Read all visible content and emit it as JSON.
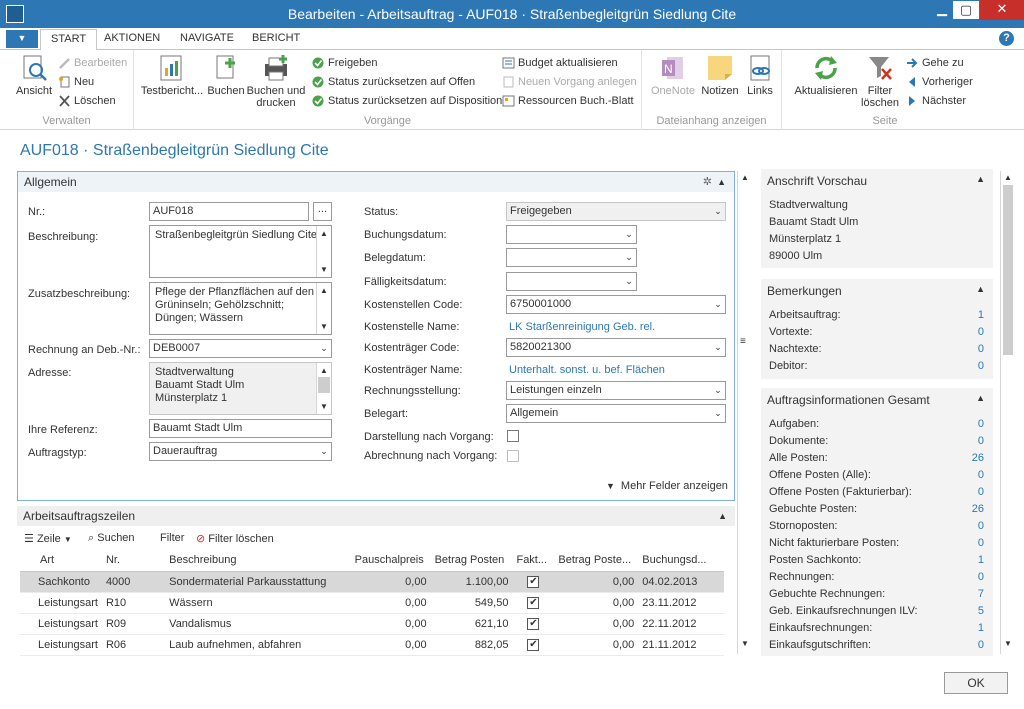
{
  "window": {
    "title": "Bearbeiten - Arbeitsauftrag - AUF018 · Straßenbegleitgrün Siedlung Cite",
    "minimize": "▁",
    "maximize": "▢",
    "close": "✕"
  },
  "ribbon_tabs": [
    "START",
    "AKTIONEN",
    "NAVIGATE",
    "BERICHT"
  ],
  "ribbon": {
    "verwalten": {
      "label": "Verwalten",
      "ansicht": "Ansicht",
      "bearbeiten": "Bearbeiten",
      "neu": "Neu",
      "loeschen": "Löschen"
    },
    "vorgaenge": {
      "label": "Vorgänge",
      "testbericht": "Testbericht...",
      "buchen": "Buchen",
      "buchen_drucken_1": "Buchen und",
      "buchen_drucken_2": "drucken",
      "freigeben": "Freigeben",
      "status_offen": "Status zurücksetzen auf Offen",
      "status_disposition": "Status zurücksetzen auf Disposition",
      "budget": "Budget aktualisieren",
      "neuer_vorgang": "Neuen Vorgang anlegen",
      "ressourcen": "Ressourcen Buch.-Blatt"
    },
    "dateianhang": {
      "label": "Dateianhang anzeigen",
      "onenote": "OneNote",
      "notizen": "Notizen",
      "links": "Links"
    },
    "seite": {
      "label": "Seite",
      "aktualisieren": "Aktualisieren",
      "filter_1": "Filter",
      "filter_2": "löschen",
      "gehe_zu": "Gehe zu",
      "vorheriger": "Vorheriger",
      "naechster": "Nächster"
    }
  },
  "page_title": "AUF018 · Straßenbegleitgrün Siedlung Cite",
  "allgemein": {
    "header": "Allgemein",
    "nr_label": "Nr.:",
    "nr_value": "AUF018",
    "nr_assist": "...",
    "beschreibung_label": "Beschreibung:",
    "beschreibung_value": "Straßenbegleitgrün Siedlung Cite",
    "zusatz_label": "Zusatzbeschreibung:",
    "zusatz_lines": [
      "Pflege der Pflanzflächen auf den",
      "Grüninseln; Gehölzschnitt;",
      "Düngen; Wässern"
    ],
    "rechnung_label": "Rechnung an Deb.-Nr.:",
    "rechnung_value": "DEB0007",
    "adresse_label": "Adresse:",
    "adresse_lines": [
      "Stadtverwaltung",
      "Bauamt Stadt Ulm",
      "Münsterplatz 1"
    ],
    "referenz_label": "Ihre Referenz:",
    "referenz_value": "Bauamt Stadt Ulm",
    "auftragstyp_label": "Auftragstyp:",
    "auftragstyp_value": "Dauerauftrag",
    "status_label": "Status:",
    "status_value": "Freigegeben",
    "buchungsdatum_label": "Buchungsdatum:",
    "belegdatum_label": "Belegdatum:",
    "faelligkeit_label": "Fälligkeitsdatum:",
    "kst_code_label": "Kostenstellen Code:",
    "kst_code_value": "6750001000",
    "kst_name_label": "Kostenstelle Name:",
    "kst_name_value": "LK Starßenreinigung Geb. rel.",
    "ktr_code_label": "Kostenträger Code:",
    "ktr_code_value": "5820021300",
    "ktr_name_label": "Kostenträger Name:",
    "ktr_name_value": "Unterhalt. sonst. u. bef. Flächen",
    "rechnungsstellung_label": "Rechnungsstellung:",
    "rechnungsstellung_value": "Leistungen einzeln",
    "belegart_label": "Belegart:",
    "belegart_value": "Allgemein",
    "darstellung_label": "Darstellung nach Vorgang:",
    "abrechnung_label": "Abrechnung nach Vorgang:",
    "mehr_felder": "Mehr Felder anzeigen"
  },
  "zeilen": {
    "header": "Arbeitsauftragszeilen",
    "toolbar": {
      "zeile": "Zeile",
      "suchen": "Suchen",
      "filter": "Filter",
      "filter_loeschen": "Filter löschen"
    },
    "columns": [
      "Art",
      "Nr.",
      "Beschreibung",
      "Pauschalpreis",
      "Betrag Posten",
      "Fakt...",
      "Betrag Poste...",
      "Buchungsd..."
    ],
    "rows": [
      {
        "art": "Sachkonto",
        "nr": "4000",
        "beschreibung": "Sondermaterial Parkausstattung",
        "pauschal": "0,00",
        "betrag": "1.100,00",
        "fakt": true,
        "betrag2": "0,00",
        "datum": "04.02.2013"
      },
      {
        "art": "Leistungsart",
        "nr": "R10",
        "beschreibung": "Wässern",
        "pauschal": "0,00",
        "betrag": "549,50",
        "fakt": true,
        "betrag2": "0,00",
        "datum": "23.11.2012"
      },
      {
        "art": "Leistungsart",
        "nr": "R09",
        "beschreibung": "Vandalismus",
        "pauschal": "0,00",
        "betrag": "621,10",
        "fakt": true,
        "betrag2": "0,00",
        "datum": "22.11.2012"
      },
      {
        "art": "Leistungsart",
        "nr": "R06",
        "beschreibung": "Laub aufnehmen, abfahren",
        "pauschal": "0,00",
        "betrag": "882,05",
        "fakt": true,
        "betrag2": "0,00",
        "datum": "21.11.2012"
      }
    ]
  },
  "anschrift": {
    "header": "Anschrift Vorschau",
    "lines": [
      "Stadtverwaltung",
      "Bauamt Stadt Ulm",
      "Münsterplatz 1",
      "89000 Ulm"
    ]
  },
  "bemerkungen": {
    "header": "Bemerkungen",
    "rows": [
      {
        "k": "Arbeitsauftrag:",
        "v": "1"
      },
      {
        "k": "Vortexte:",
        "v": "0"
      },
      {
        "k": "Nachtexte:",
        "v": "0"
      },
      {
        "k": "Debitor:",
        "v": "0"
      }
    ]
  },
  "auftragsinfo": {
    "header": "Auftragsinformationen Gesamt",
    "rows": [
      {
        "k": "Aufgaben:",
        "v": "0"
      },
      {
        "k": "Dokumente:",
        "v": "0"
      },
      {
        "k": "Alle Posten:",
        "v": "26"
      },
      {
        "k": "Offene Posten (Alle):",
        "v": "0"
      },
      {
        "k": "Offene Posten (Fakturierbar):",
        "v": "0"
      },
      {
        "k": "Gebuchte Posten:",
        "v": "26"
      },
      {
        "k": "Stornoposten:",
        "v": "0"
      },
      {
        "k": "Nicht fakturierbare Posten:",
        "v": "0"
      },
      {
        "k": "Posten Sachkonto:",
        "v": "1"
      },
      {
        "k": "Rechnungen:",
        "v": "0"
      },
      {
        "k": "Gebuchte Rechnungen:",
        "v": "7"
      },
      {
        "k": "Geb. Einkaufsrechnungen ILV:",
        "v": "5"
      },
      {
        "k": "Einkaufsrechnungen:",
        "v": "1"
      },
      {
        "k": "Einkaufsgutschriften:",
        "v": "0"
      }
    ]
  },
  "ok_button": "OK"
}
